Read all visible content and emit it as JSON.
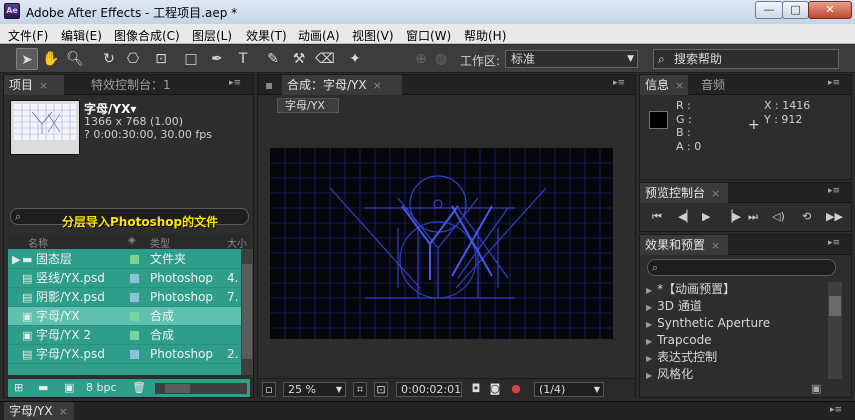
{
  "window": {
    "title": "Adobe After Effects - 工程项目.aep *",
    "app_icon_label": "Ae",
    "min_glyph": "—",
    "max_glyph": "□",
    "close_glyph": "✕"
  },
  "menubar": {
    "items": [
      "文件(F)",
      "编辑(E)",
      "图像合成(C)",
      "图层(L)",
      "效果(T)",
      "动画(A)",
      "视图(V)",
      "窗口(W)",
      "帮助(H)"
    ]
  },
  "toolbar": {
    "workspace_label": "工作区:",
    "workspace_value": "标准",
    "help_search_placeholder": "搜索帮助"
  },
  "project_panel": {
    "tabs": [
      "项目",
      "特效控制台：1"
    ],
    "comp_name": "字母/YX▾",
    "comp_size": "1366 x 768 (1.00)",
    "comp_duration": "? 0:00:30:00, 30.00 fps",
    "annotation": "分层导入Photoshop的文件",
    "columns": [
      "名称",
      "类型",
      "大小"
    ],
    "rows": [
      {
        "icon": "folder",
        "name": "固态层",
        "label_color": "#7ed38f",
        "type": "文件夹",
        "size": ""
      },
      {
        "icon": "psd",
        "name": "竖线/YX.psd",
        "label_color": "#8cc3d8",
        "type": "Photoshop",
        "size": "4."
      },
      {
        "icon": "psd",
        "name": "阴影/YX.psd",
        "label_color": "#8cc3d8",
        "type": "Photoshop",
        "size": "7."
      },
      {
        "icon": "comp",
        "name": "字母/YX",
        "label_color": "#78d3a3",
        "type": "合成",
        "size": "",
        "selected": true
      },
      {
        "icon": "comp",
        "name": "字母/YX 2",
        "label_color": "#78d3a3",
        "type": "合成",
        "size": ""
      },
      {
        "icon": "psd",
        "name": "字母/YX.psd",
        "label_color": "#8cc3d8",
        "type": "Photoshop",
        "size": "2."
      }
    ],
    "bpc": "8 bpc"
  },
  "composition_panel": {
    "tab_title": "合成：字母/YX",
    "breadcrumb": "字母/YX",
    "zoom": "25 %",
    "timecode": "0:00:02:01",
    "resolution": "(1/4)"
  },
  "info_panel": {
    "tabs": [
      "信息",
      "音频"
    ],
    "r_label": "R :",
    "g_label": "G :",
    "b_label": "B :",
    "a_label": "A : 0",
    "x_label": "X : 1416",
    "y_label": "Y : 912"
  },
  "preview_panel": {
    "tab": "预览控制台"
  },
  "effects_panel": {
    "tab": "效果和预置",
    "items": [
      "*【动画预置】",
      "3D 通道",
      "Synthetic Aperture",
      "Trapcode",
      "表达式控制",
      "风格化"
    ]
  },
  "timeline": {
    "tab": "字母/YX"
  },
  "colors": {
    "selection_teal": "#2e9e8a",
    "selected_row": "#5fc2ae",
    "annotation_yellow": "#ffe600",
    "grid_blue": "#1a2480"
  }
}
